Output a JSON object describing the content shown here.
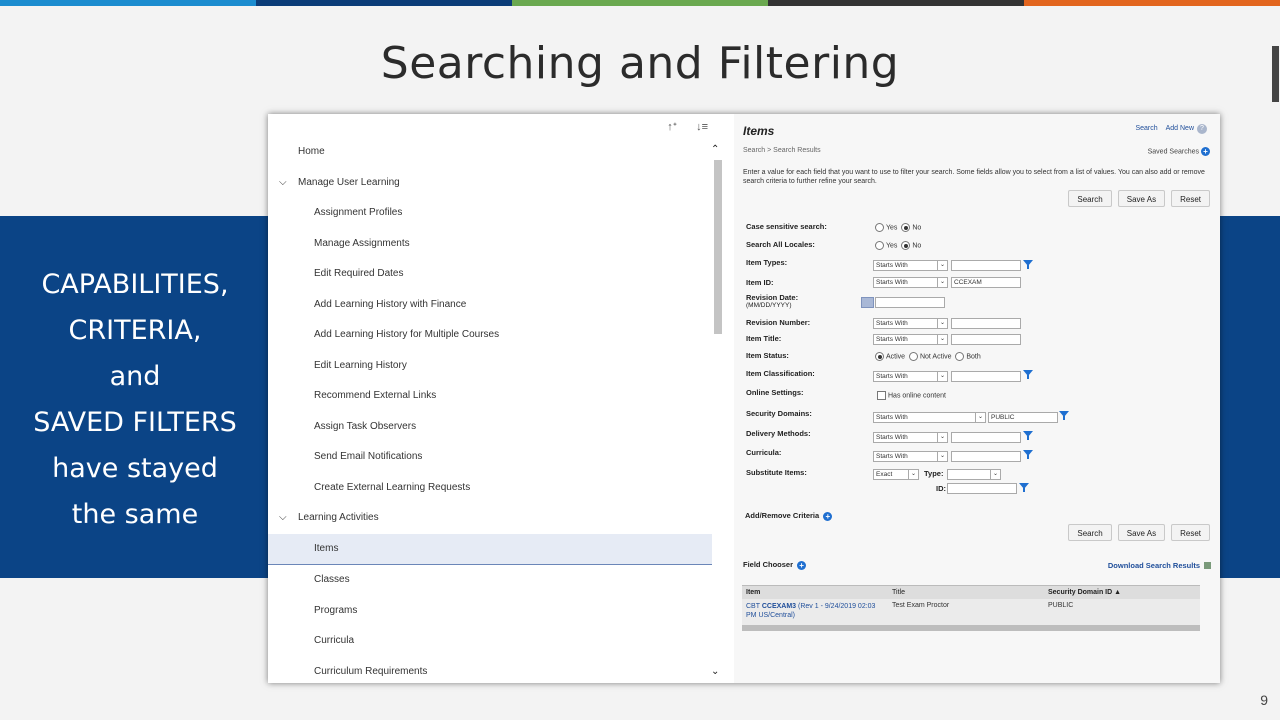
{
  "slide": {
    "title": "Searching and Filtering",
    "left_text_lines": [
      "CAPABILITIES,",
      "CRITERIA,",
      "and",
      "SAVED FILTERS",
      "have stayed",
      "the same"
    ],
    "page_number": "9",
    "colors": {
      "band": "#0b4486",
      "topbar": [
        "#1b8ccf",
        "#0b3c78",
        "#6aa84f",
        "#333333",
        "#e2651e"
      ]
    }
  },
  "nav": {
    "tools": [
      "↑ᐩ",
      "↓≡"
    ],
    "items": [
      {
        "label": "Home",
        "level": 0
      },
      {
        "label": "Manage User Learning",
        "level": 1,
        "expanded": true
      },
      {
        "label": "Assignment Profiles",
        "level": 2
      },
      {
        "label": "Manage Assignments",
        "level": 2
      },
      {
        "label": "Edit Required Dates",
        "level": 2
      },
      {
        "label": "Add Learning History with Finance",
        "level": 2
      },
      {
        "label": "Add Learning History for Multiple Courses",
        "level": 2
      },
      {
        "label": "Edit Learning History",
        "level": 2
      },
      {
        "label": "Recommend External Links",
        "level": 2
      },
      {
        "label": "Assign Task Observers",
        "level": 2
      },
      {
        "label": "Send Email Notifications",
        "level": 2
      },
      {
        "label": "Create External Learning Requests",
        "level": 2
      },
      {
        "label": "Learning Activities",
        "level": 1,
        "expanded": true
      },
      {
        "label": "Items",
        "level": 2,
        "selected": true
      },
      {
        "label": "Classes",
        "level": 2
      },
      {
        "label": "Programs",
        "level": 2
      },
      {
        "label": "Curricula",
        "level": 2
      },
      {
        "label": "Curriculum Requirements",
        "level": 2
      }
    ]
  },
  "app": {
    "title": "Items",
    "header_links": [
      "Search",
      "Add New"
    ],
    "breadcrumb": "Search > Search Results",
    "saved_searches": "Saved Searches",
    "instructions": "Enter a value for each field that you want to use to filter your search. Some fields allow you to select from a list of values. You can also add or remove search criteria to further refine your search.",
    "buttons": {
      "search": "Search",
      "save_as": "Save As",
      "reset": "Reset"
    },
    "fields": {
      "case_sensitive": {
        "label": "Case sensitive search:",
        "yes": "Yes",
        "no": "No",
        "selected": "No"
      },
      "all_locales": {
        "label": "Search All Locales:",
        "yes": "Yes",
        "no": "No",
        "selected": "No"
      },
      "item_types": {
        "label": "Item Types:",
        "operator": "Starts With",
        "value": ""
      },
      "item_id": {
        "label": "Item ID:",
        "operator": "Starts With",
        "value": "CCEXAM"
      },
      "revision_date": {
        "label": "Revision Date:",
        "hint": "(MM/DD/YYYY)",
        "value": ""
      },
      "revision_number": {
        "label": "Revision Number:",
        "operator": "Starts With",
        "value": ""
      },
      "item_title": {
        "label": "Item Title:",
        "operator": "Starts With",
        "value": ""
      },
      "item_status": {
        "label": "Item Status:",
        "options": [
          "Active",
          "Not Active",
          "Both"
        ],
        "selected": "Active"
      },
      "item_classification": {
        "label": "Item Classification:",
        "operator": "Starts With",
        "value": ""
      },
      "online_settings": {
        "label": "Online Settings:",
        "checkbox_label": "Has online content"
      },
      "security_domains": {
        "label": "Security Domains:",
        "operator": "Starts With",
        "value": "PUBLIC"
      },
      "delivery_methods": {
        "label": "Delivery Methods:",
        "operator": "Starts With",
        "value": ""
      },
      "curricula": {
        "label": "Curricula:",
        "operator": "Starts With",
        "value": ""
      },
      "substitute_items": {
        "label": "Substitute Items:",
        "operator": "Exact",
        "type_label": "Type:",
        "id_label": "ID:"
      }
    },
    "add_remove_criteria": "Add/Remove Criteria",
    "field_chooser": "Field Chooser",
    "download": "Download Search Results",
    "table": {
      "columns": [
        "Item",
        "Title",
        "Security Domain ID ▲"
      ],
      "rows": [
        {
          "item_prefix": "CBT ",
          "item_id": "CCEXAM3",
          "item_suffix": " (Rev 1 - 9/24/2019 02:03 PM US/Central)",
          "title": "Test Exam Proctor",
          "domain": "PUBLIC"
        }
      ]
    }
  }
}
